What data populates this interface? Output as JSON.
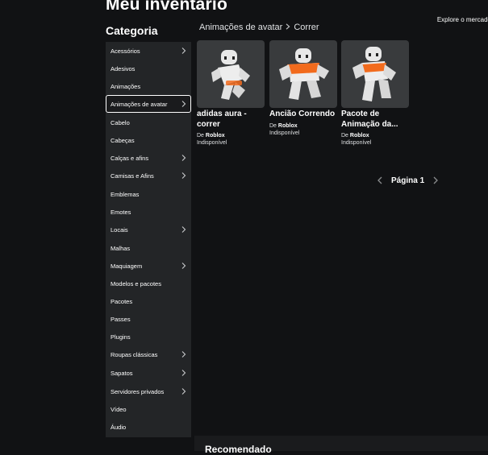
{
  "header": {
    "title": "Meu inventário",
    "explore_link": "Explore o mercado"
  },
  "breadcrumb": {
    "items": [
      "Animações de avatar",
      "Correr"
    ],
    "separator_icon": "chevron-right-icon"
  },
  "sidebar": {
    "heading": "Categoria",
    "selected": "Animações de avatar",
    "items": [
      {
        "label": "Acessórios",
        "has_submenu": true
      },
      {
        "label": "Adesivos",
        "has_submenu": false
      },
      {
        "label": "Animações",
        "has_submenu": false
      },
      {
        "label": "Animações de avatar",
        "has_submenu": true
      },
      {
        "label": "Cabelo",
        "has_submenu": false
      },
      {
        "label": "Cabeças",
        "has_submenu": false
      },
      {
        "label": "Calças e afins",
        "has_submenu": true
      },
      {
        "label": "Camisas e Afins",
        "has_submenu": true
      },
      {
        "label": "Emblemas",
        "has_submenu": false
      },
      {
        "label": "Emotes",
        "has_submenu": false
      },
      {
        "label": "Locais",
        "has_submenu": true
      },
      {
        "label": "Malhas",
        "has_submenu": false
      },
      {
        "label": "Maquiagem",
        "has_submenu": true
      },
      {
        "label": "Modelos e pacotes",
        "has_submenu": false
      },
      {
        "label": "Pacotes",
        "has_submenu": false
      },
      {
        "label": "Passes",
        "has_submenu": false
      },
      {
        "label": "Plugins",
        "has_submenu": false
      },
      {
        "label": "Roupas clássicas",
        "has_submenu": true
      },
      {
        "label": "Sapatos",
        "has_submenu": true
      },
      {
        "label": "Servidores privados",
        "has_submenu": true
      },
      {
        "label": "Vídeo",
        "has_submenu": false
      },
      {
        "label": "Áudio",
        "has_submenu": false
      }
    ]
  },
  "items": [
    {
      "name": "adidas aura - correr",
      "creator_prefix": "De",
      "creator": "Roblox",
      "status": "Indisponível",
      "thumbnail_icon": "avatar-running-icon",
      "accent": ""
    },
    {
      "name": "Ancião Correndo",
      "creator_prefix": "De",
      "creator": "Roblox",
      "status": "Indisponível",
      "thumbnail_icon": "avatar-running-icon",
      "accent": "#f26b1d"
    },
    {
      "name": "Pacote de Animação da...",
      "creator_prefix": "De",
      "creator": "Roblox",
      "status": "Indisponível",
      "thumbnail_icon": "avatar-running-icon",
      "accent": "#f26b1d"
    }
  ],
  "pagination": {
    "label": "Página 1",
    "prev_icon": "chevron-left-icon",
    "next_icon": "chevron-right-icon"
  },
  "recommended": {
    "title": "Recomendado"
  },
  "colors": {
    "background": "#111214",
    "sidebar": "#232527",
    "thumbnail": "#393b3d",
    "accent": "#f26b1d"
  }
}
